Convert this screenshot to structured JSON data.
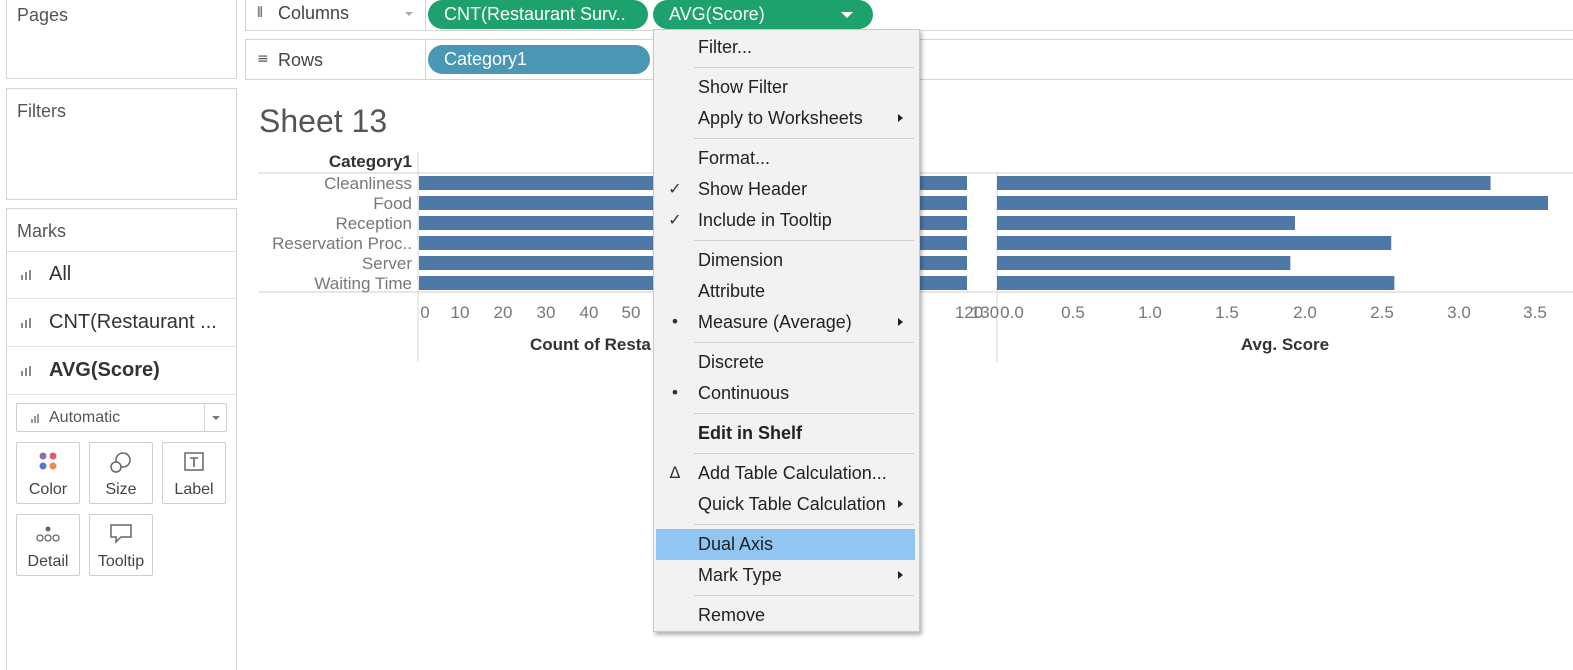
{
  "panels": {
    "pages_title": "Pages",
    "filters_title": "Filters",
    "marks_title": "Marks",
    "marks_rows": [
      {
        "label": "All",
        "bold": false
      },
      {
        "label": "CNT(Restaurant ...",
        "bold": false
      },
      {
        "label": "AVG(Score)",
        "bold": true
      }
    ],
    "mark_type": "Automatic",
    "cards": [
      "Color",
      "Size",
      "Label",
      "Detail",
      "Tooltip"
    ]
  },
  "shelves": {
    "columns_label": "Columns",
    "rows_label": "Rows",
    "columns_pills": [
      "CNT(Restaurant Surv..",
      "AVG(Score)"
    ],
    "rows_pills": [
      "Category1"
    ]
  },
  "sheet": {
    "title": "Sheet 13"
  },
  "chart_data": {
    "type": "bar",
    "orientation": "horizontal",
    "row_header": "Category1",
    "categories": [
      "Cleanliness",
      "Food",
      "Reception",
      "Reservation Proc..",
      "Server",
      "Waiting Time"
    ],
    "bar_color": "#4e79a7",
    "panes": [
      {
        "xlabel": "Count of Resta",
        "axis_max": 130,
        "ticks": [
          0,
          10,
          20,
          30,
          40,
          50,
          120,
          130
        ],
        "values": [
          130,
          130,
          130,
          130,
          130,
          130
        ]
      },
      {
        "xlabel": "Avg. Score",
        "axis_max": 3.55,
        "ticks": [
          "0.0",
          "0.5",
          "1.0",
          "1.5",
          "2.0",
          "2.5",
          "3.0",
          "3.5"
        ],
        "values": [
          3.18,
          3.56,
          1.92,
          2.54,
          1.89,
          2.56
        ]
      }
    ],
    "grid": false
  },
  "context_menu": {
    "items": [
      {
        "label": "Filter...",
        "mark": "",
        "submenu": false
      },
      {
        "sep": true
      },
      {
        "label": "Show Filter",
        "mark": "",
        "submenu": false
      },
      {
        "label": "Apply to Worksheets",
        "mark": "",
        "submenu": true
      },
      {
        "sep": true
      },
      {
        "label": "Format...",
        "mark": "",
        "submenu": false
      },
      {
        "label": "Show Header",
        "mark": "check",
        "submenu": false
      },
      {
        "label": "Include in Tooltip",
        "mark": "check",
        "submenu": false
      },
      {
        "sep": true
      },
      {
        "label": "Dimension",
        "mark": "",
        "submenu": false
      },
      {
        "label": "Attribute",
        "mark": "",
        "submenu": false
      },
      {
        "label": "Measure (Average)",
        "mark": "bullet",
        "submenu": true
      },
      {
        "sep": true
      },
      {
        "label": "Discrete",
        "mark": "",
        "submenu": false
      },
      {
        "label": "Continuous",
        "mark": "bullet",
        "submenu": false
      },
      {
        "sep": true
      },
      {
        "label": "Edit in Shelf",
        "mark": "",
        "submenu": false,
        "bold": true
      },
      {
        "sep": true
      },
      {
        "label": "Add Table Calculation...",
        "mark": "delta",
        "submenu": false
      },
      {
        "label": "Quick Table Calculation",
        "mark": "",
        "submenu": true
      },
      {
        "sep": true
      },
      {
        "label": "Dual Axis",
        "mark": "",
        "submenu": false,
        "highlighted": true
      },
      {
        "label": "Mark Type",
        "mark": "",
        "submenu": true
      },
      {
        "sep": true
      },
      {
        "label": "Remove",
        "mark": "",
        "submenu": false
      }
    ]
  }
}
